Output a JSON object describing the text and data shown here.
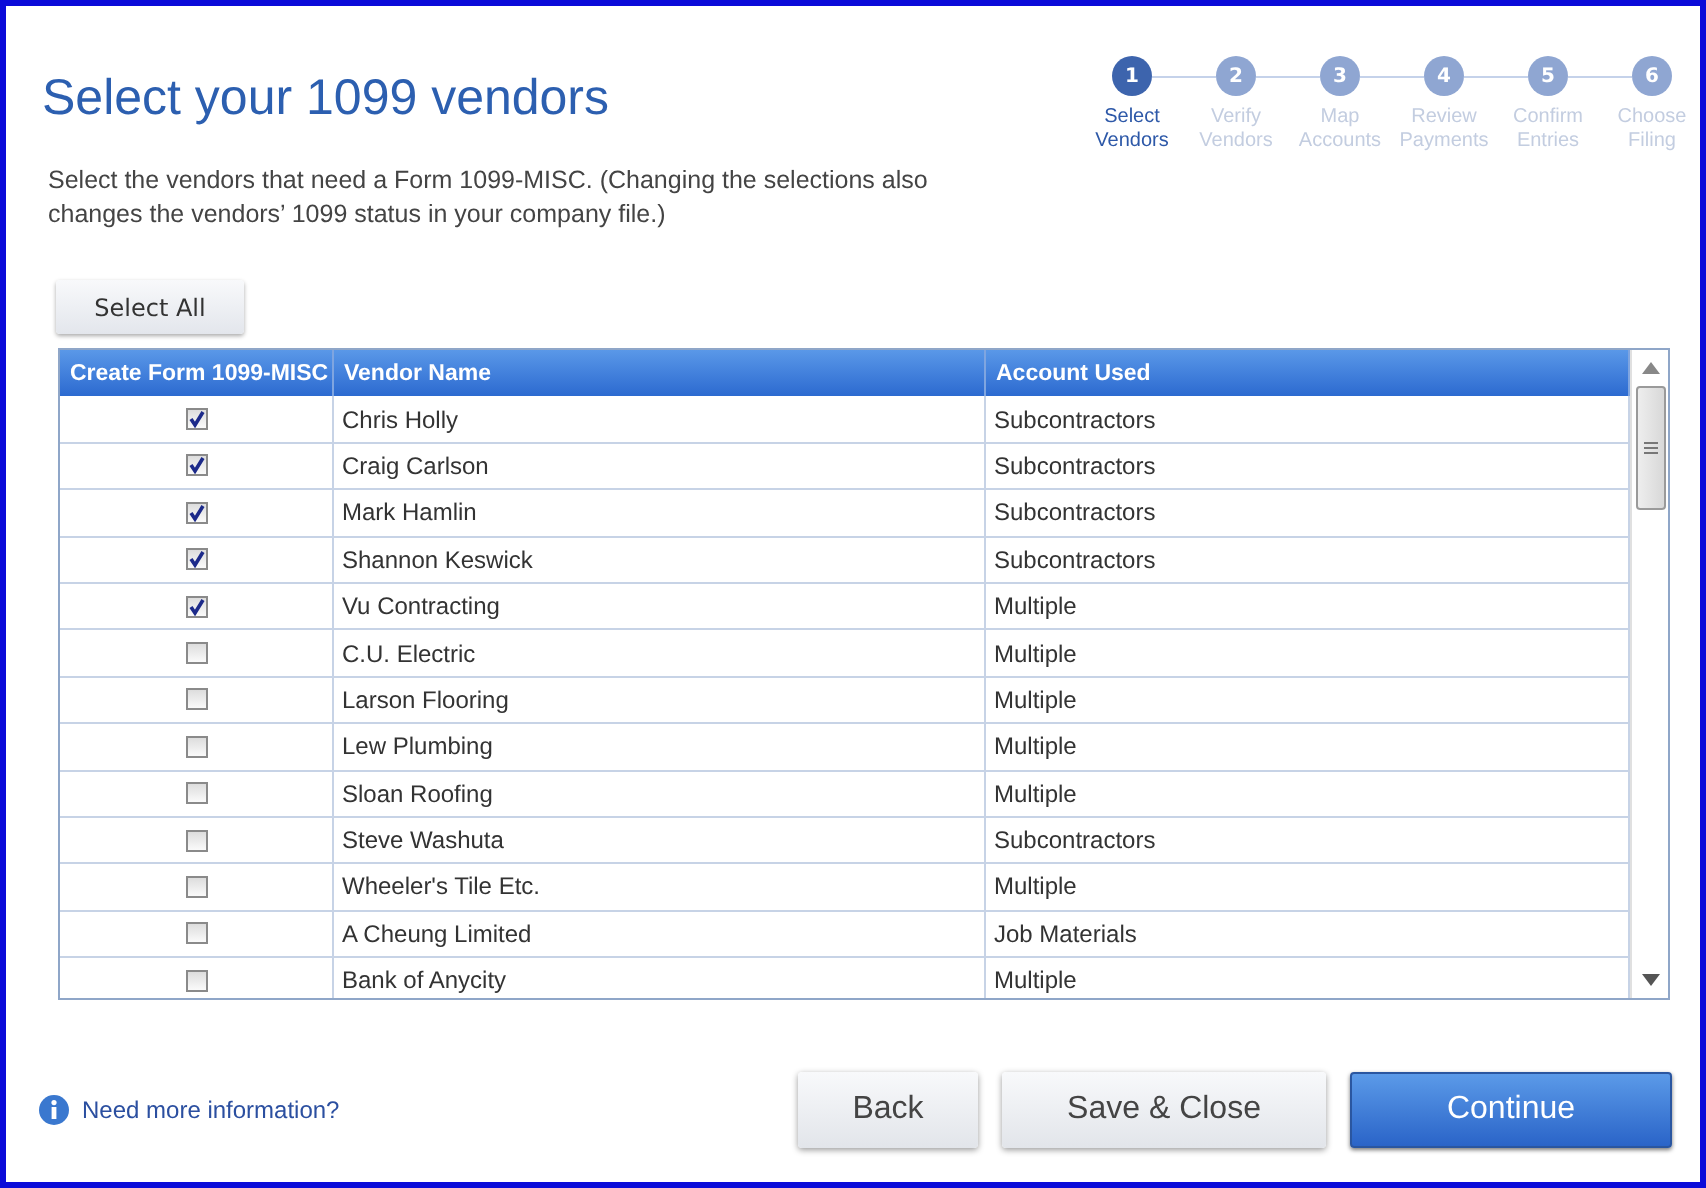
{
  "title": "Select your 1099 vendors",
  "steps": [
    {
      "number": "1",
      "label": "Select Vendors",
      "selected": true
    },
    {
      "number": "2",
      "label": "Verify Vendors",
      "selected": false
    },
    {
      "number": "3",
      "label": "Map Accounts",
      "selected": false
    },
    {
      "number": "4",
      "label": "Review Payments",
      "selected": false
    },
    {
      "number": "5",
      "label": "Confirm Entries",
      "selected": false
    },
    {
      "number": "6",
      "label": "Choose Filing",
      "selected": false
    }
  ],
  "description": "Select the vendors that need a Form 1099-MISC. (Changing the selections also changes the vendors’ 1099 status in your company file.)",
  "select_all_button": "Select All",
  "table": {
    "columns": [
      "Create Form 1099-MISC",
      "Vendor Name",
      "Account Used"
    ],
    "rows": [
      {
        "checked": true,
        "vendor": "Chris Holly",
        "account": "Subcontractors"
      },
      {
        "checked": true,
        "vendor": "Craig Carlson",
        "account": "Subcontractors"
      },
      {
        "checked": true,
        "vendor": "Mark Hamlin",
        "account": "Subcontractors"
      },
      {
        "checked": true,
        "vendor": "Shannon Keswick",
        "account": "Subcontractors"
      },
      {
        "checked": true,
        "vendor": "Vu Contracting",
        "account": "Multiple"
      },
      {
        "checked": false,
        "vendor": "C.U. Electric",
        "account": "Multiple"
      },
      {
        "checked": false,
        "vendor": "Larson Flooring",
        "account": "Multiple"
      },
      {
        "checked": false,
        "vendor": "Lew Plumbing",
        "account": "Multiple"
      },
      {
        "checked": false,
        "vendor": "Sloan Roofing",
        "account": "Multiple"
      },
      {
        "checked": false,
        "vendor": "Steve Washuta",
        "account": "Subcontractors"
      },
      {
        "checked": false,
        "vendor": "Wheeler's Tile Etc.",
        "account": "Multiple"
      },
      {
        "checked": false,
        "vendor": "A Cheung Limited",
        "account": "Job Materials"
      },
      {
        "checked": false,
        "vendor": "Bank of Anycity",
        "account": "Multiple"
      }
    ]
  },
  "help_link": "Need more information?",
  "buttons": [
    {
      "label": "Back",
      "kind": "secondary"
    },
    {
      "label": "Save & Close",
      "kind": "secondary"
    },
    {
      "label": "Continue",
      "kind": "primary"
    }
  ]
}
